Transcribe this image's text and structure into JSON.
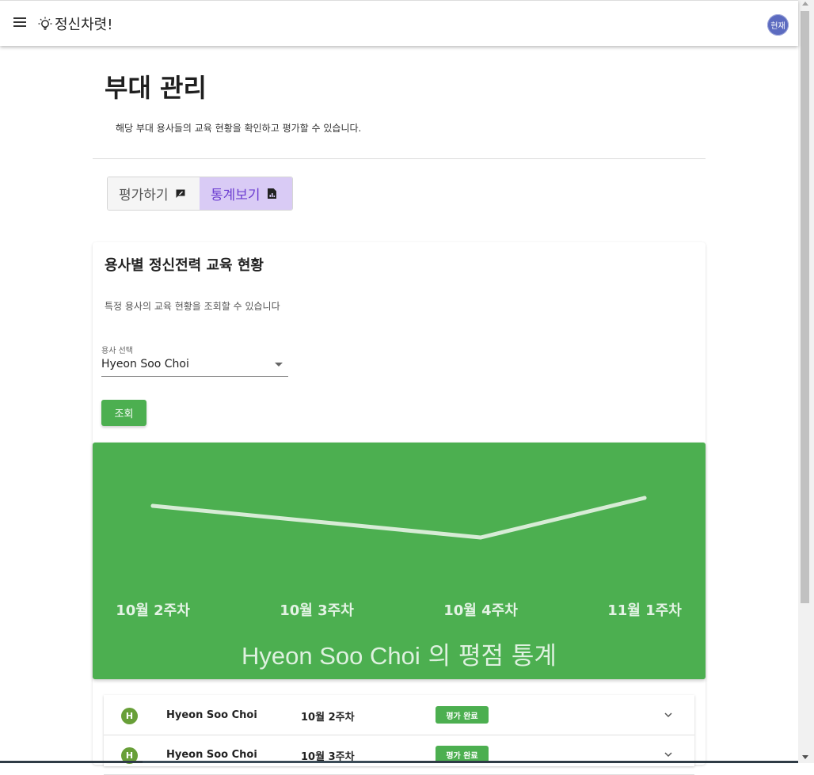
{
  "app": {
    "title": "정신차렷!",
    "avatar_label": "현재"
  },
  "page": {
    "title": "부대 관리",
    "description": "해당 부대 용사들의 교육 현황을 확인하고 평가할 수 있습니다."
  },
  "tabs": [
    {
      "label": "평가하기",
      "icon": "rate-review-icon",
      "active": false
    },
    {
      "label": "통계보기",
      "icon": "report-icon",
      "active": true
    }
  ],
  "card": {
    "title": "용사별 정신전력 교육 현황",
    "subtitle": "특정 용사의 교육 현황을 조회할 수 있습니다",
    "select_label": "용사 선택",
    "select_value": "Hyeon Soo Choi",
    "query_button": "조회"
  },
  "chart_data": {
    "type": "line",
    "categories": [
      "10월 2주차",
      "10월 3주차",
      "10월 4주차",
      "11월 1주차"
    ],
    "values": [
      3.6,
      3.4,
      3.2,
      3.7
    ],
    "ylim": [
      2.8,
      4.0
    ],
    "title_name": "Hyeon Soo Choi",
    "title_suffix": " 의 평점 통계",
    "colors": {
      "background": "#4caf50",
      "line": "#d7ecd6"
    }
  },
  "list": [
    {
      "avatar": "H",
      "name": "Hyeon Soo Choi",
      "week": "10월 2주차",
      "status": "평가 완료"
    },
    {
      "avatar": "H",
      "name": "Hyeon Soo Choi",
      "week": "10월 3주차",
      "status": "평가 완료"
    }
  ]
}
